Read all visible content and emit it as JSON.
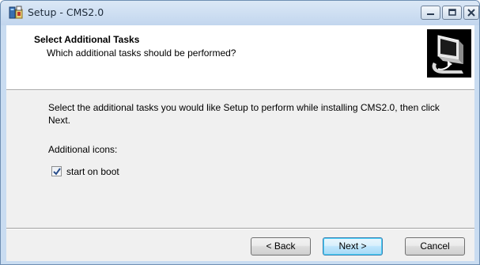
{
  "window": {
    "title": "Setup - CMS2.0",
    "icon": "setup-installer-icon",
    "controls": [
      "minimize-icon",
      "maximize-icon",
      "close-icon"
    ]
  },
  "header": {
    "title": "Select Additional Tasks",
    "subtitle": "Which additional tasks should be performed?",
    "logo": "computer-install-icon"
  },
  "main": {
    "description": "Select the additional tasks you would like Setup to perform while installing CMS2.0, then click Next.",
    "group_label": "Additional icons:",
    "tasks": [
      {
        "label": "start on boot",
        "checked": true
      }
    ]
  },
  "footer": {
    "back_label": "< Back",
    "next_label": "Next >",
    "cancel_label": "Cancel"
  },
  "colors": {
    "title_bar": "#c2d6ee",
    "client_background": "#f0f0f0",
    "default_button_border": "#3c7fb1"
  }
}
